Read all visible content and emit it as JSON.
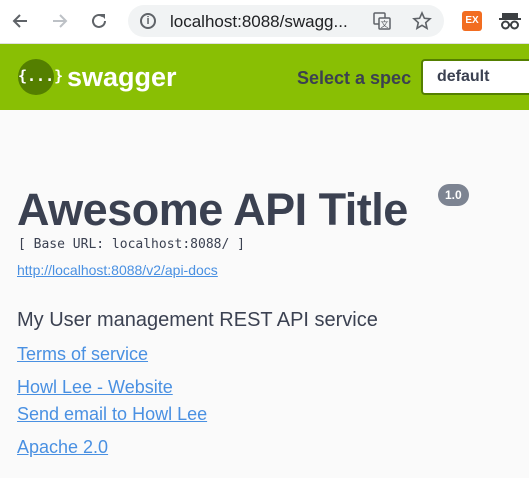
{
  "browser": {
    "url": "localhost:8088/swagg...",
    "ext_label": "EX"
  },
  "header": {
    "logo_glyph": "{...}",
    "logo_text": "swagger",
    "select_label": "Select a spec",
    "select_value": "default"
  },
  "info": {
    "title": "Awesome API Title",
    "version": "1.0",
    "base_url": "[ Base URL: localhost:8088/ ]",
    "api_docs_link": "http://localhost:8088/v2/api-docs",
    "description": "My User management REST API service",
    "terms_link": "Terms of service",
    "website_link": "Howl Lee - Website",
    "email_link": "Send email to Howl Lee",
    "license_link": "Apache 2.0"
  },
  "colors": {
    "topbar": "#89bf04",
    "logo_bg": "#547f00",
    "link": "#4990e2",
    "text": "#3b4151"
  }
}
